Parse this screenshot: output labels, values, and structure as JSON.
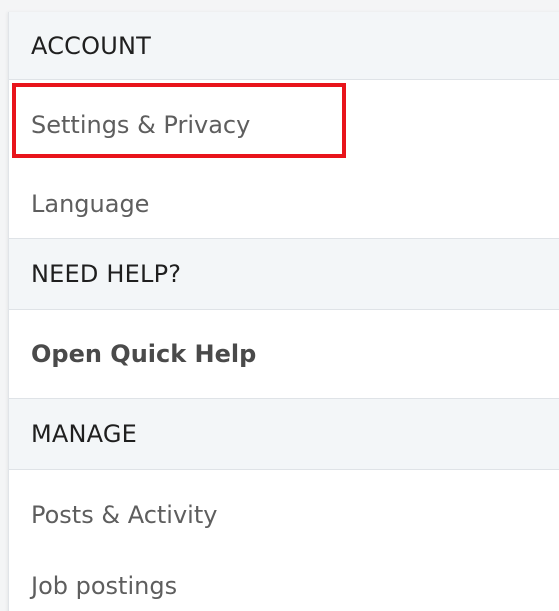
{
  "menu": {
    "account_header": "ACCOUNT",
    "settings_privacy": "Settings & Privacy",
    "language": "Language",
    "help_header": "NEED HELP?",
    "open_quick_help": "Open Quick Help",
    "manage_header": "MANAGE",
    "posts_activity": "Posts & Activity",
    "job_postings": "Job postings"
  },
  "colors": {
    "highlight": "#e8141b",
    "header_bg": "#f3f6f8"
  }
}
